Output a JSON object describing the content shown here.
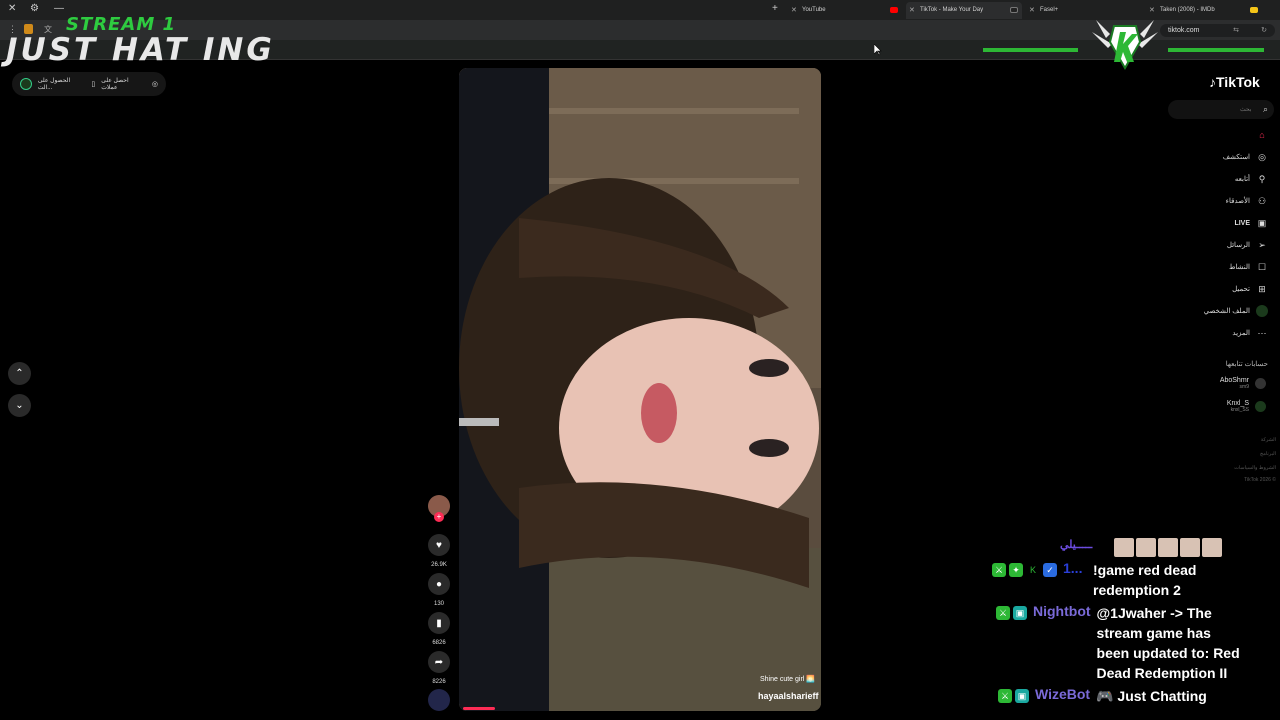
{
  "browser": {
    "tabs": [
      {
        "title": "YouTube",
        "active": false,
        "favicon_color": "#ff0000"
      },
      {
        "title": "TikTok - Make Your Day",
        "active": true,
        "favicon_color": "#222222"
      },
      {
        "title": "Fasel+",
        "active": false,
        "favicon_color": "#d4a20c"
      },
      {
        "title": "Taken (2008) - IMDb",
        "active": false,
        "favicon_color": "#f5c518"
      }
    ],
    "url": "tiktok.com"
  },
  "overlay": {
    "line1": "STREAM 1",
    "line2": "JUST  HAT  ING"
  },
  "top_chip": {
    "get_coins": "احصل على عملات",
    "get_app": "الحصول على الت..."
  },
  "video": {
    "caption": "Shine cute girl 🌅",
    "handle": "hayaalsharieff",
    "likes": "26.9K",
    "comments": "130",
    "saves": "6826",
    "shares": "8226",
    "progress_fraction": 0.09
  },
  "sidebar": {
    "brand": "TikTok",
    "search_placeholder": "بحث",
    "items": [
      {
        "label": "",
        "icon": "home-icon"
      },
      {
        "label": "استكشف",
        "icon": "compass-icon"
      },
      {
        "label": "أتابعه",
        "icon": "following-icon"
      },
      {
        "label": "الأصدقاء",
        "icon": "friends-icon"
      },
      {
        "label": "LIVE",
        "icon": "live-icon"
      },
      {
        "label": "الرسائل",
        "icon": "messages-icon"
      },
      {
        "label": "النشاط",
        "icon": "activity-icon"
      },
      {
        "label": "تحميل",
        "icon": "upload-icon"
      },
      {
        "label": "الملف الشخصي",
        "icon": "profile-icon"
      },
      {
        "label": "المزيد",
        "icon": "more-icon"
      }
    ],
    "following_title": "حسابات تتابعها",
    "accounts": [
      {
        "name": "AboShmr",
        "sub": "sm9"
      },
      {
        "name": "Knxl_S",
        "sub": "knxl_SS"
      }
    ],
    "footer": [
      "الشركة",
      "البرنامج",
      "الشروط والسياسات",
      "TikTok 2026 ©"
    ]
  },
  "chat": [
    {
      "user": "ـــــيلي",
      "user_color": "#6c4ce0",
      "message": "",
      "emotes": 5
    },
    {
      "user": "1...",
      "user_color": "#2a3fd8",
      "message": "!game red dead redemption 2"
    },
    {
      "user": "Nightbot",
      "user_color": "#7a6ad8",
      "message": "@1Jwaher -> The stream game has been updated to: Red Dead Redemption II"
    },
    {
      "user": "WizeBot",
      "user_color": "#7a6ad8",
      "message": "🎮 Just Chatting"
    }
  ]
}
